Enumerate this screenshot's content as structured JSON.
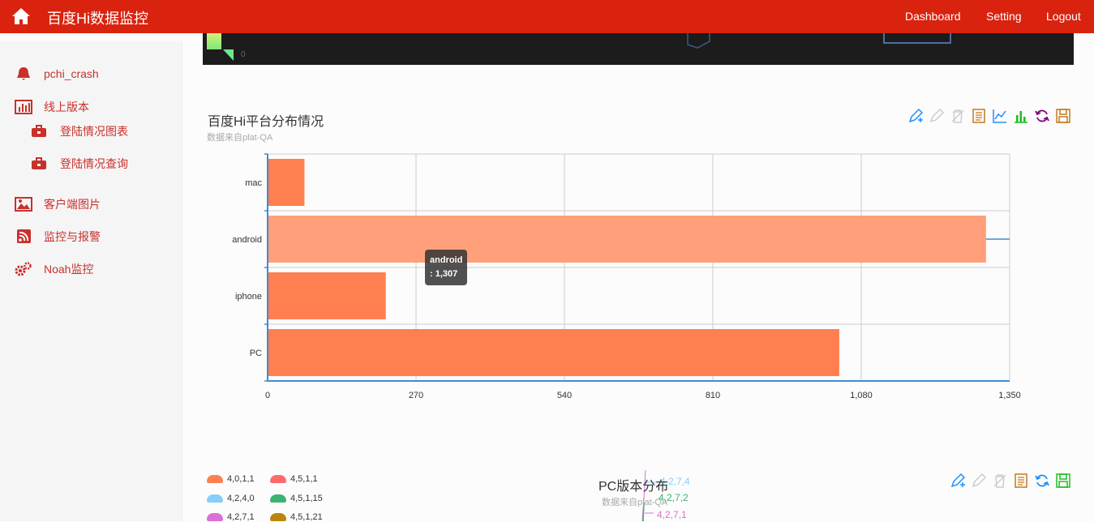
{
  "navbar": {
    "brand": "百度Hi数据监控",
    "links": [
      "Dashboard",
      "Setting",
      "Logout"
    ]
  },
  "sidebar": {
    "items": [
      {
        "label": "pchi_crash",
        "icon": "bell-icon"
      },
      {
        "label": "线上版本",
        "icon": "bar-chart-icon"
      },
      {
        "label": "登陆情况图表",
        "icon": "briefcase-icon"
      },
      {
        "label": "登陆情况查询",
        "icon": "briefcase-icon"
      },
      {
        "label": "客户端图片",
        "icon": "picture-icon"
      },
      {
        "label": "监控与报警",
        "icon": "rss-icon"
      },
      {
        "label": "Noah监控",
        "icon": "cogs-icon"
      }
    ]
  },
  "top_map": {
    "scale_label": "0"
  },
  "chart1": {
    "title": "百度Hi平台分布情况",
    "subtitle": "数据来自plat-QA",
    "tooltip": {
      "name": "android",
      "value": ": 1,307"
    },
    "toolbox_icons": [
      "mark-icon",
      "mark-undo-icon",
      "mark-clear-icon",
      "data-view-icon",
      "line-chart-icon",
      "bar-chart-icon",
      "restore-icon",
      "save-image-icon"
    ]
  },
  "chart2": {
    "title": "PC版本分布",
    "subtitle": "数据来自plat-QA",
    "legend": [
      {
        "label": "4,0,1,1",
        "color": "#ff7f50"
      },
      {
        "label": "4,5,1,1",
        "color": "#ff6b6b"
      },
      {
        "label": "4,2,4,0",
        "color": "#87cefa"
      },
      {
        "label": "4,5,1,15",
        "color": "#3cb371"
      },
      {
        "label": "4,2,7,1",
        "color": "#da70d6"
      },
      {
        "label": "4,5,1,21",
        "color": "#b8860b"
      }
    ],
    "pie_labels": [
      "4,2,7,4",
      "4,2,7,2",
      "4,2,7,1"
    ],
    "toolbox_icons": [
      "mark-icon",
      "mark-undo-icon",
      "mark-clear-icon",
      "data-view-icon",
      "restore-icon",
      "save-image-icon"
    ]
  },
  "chart_data": {
    "type": "bar",
    "orientation": "horizontal",
    "title": "百度Hi平台分布情况",
    "subtitle": "数据来自plat-QA",
    "categories": [
      "mac",
      "android",
      "iphone",
      "PC"
    ],
    "values": [
      67,
      1307,
      215,
      1040
    ],
    "xlim": [
      0,
      1350
    ],
    "x_ticks": [
      "0",
      "270",
      "540",
      "810",
      "1,080",
      "1,350"
    ],
    "colors": {
      "bar": "#ff7f50",
      "highlight": "#ffa07a",
      "axis": "#408cd4"
    },
    "grid": true
  }
}
